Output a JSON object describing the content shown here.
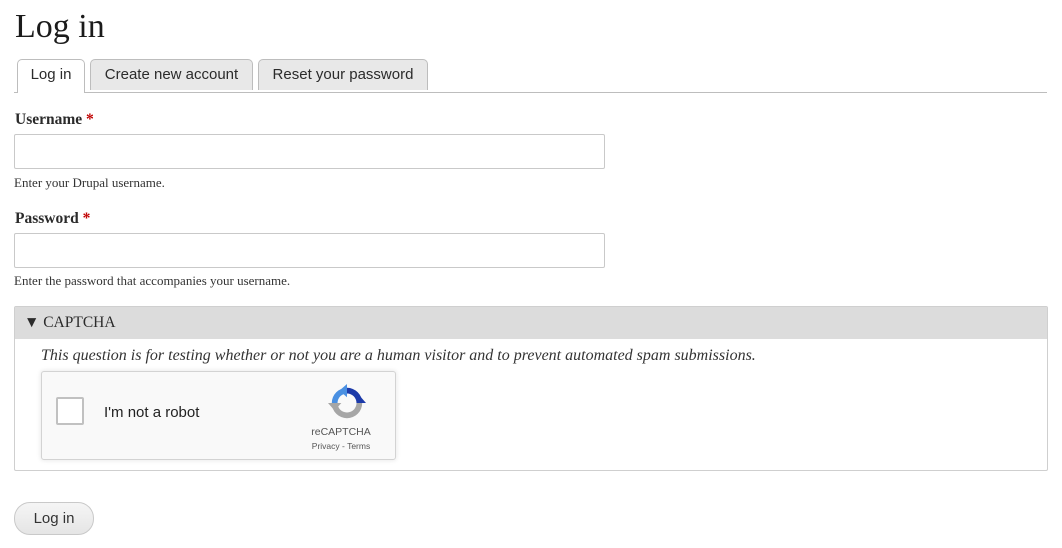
{
  "page": {
    "title": "Log in"
  },
  "tabs": [
    {
      "label": "Log in",
      "active": true
    },
    {
      "label": "Create new account",
      "active": false
    },
    {
      "label": "Reset your password",
      "active": false
    }
  ],
  "form": {
    "username": {
      "label": "Username",
      "required_marker": "*",
      "value": "",
      "help": "Enter your Drupal username."
    },
    "password": {
      "label": "Password",
      "required_marker": "*",
      "value": "",
      "help": "Enter the password that accompanies your username."
    },
    "captcha": {
      "legend": "▼ CAPTCHA",
      "description": "This question is for testing whether or not you are a human visitor and to prevent automated spam submissions.",
      "recaptcha": {
        "checkbox_label": "I'm not a robot",
        "brand": "reCAPTCHA",
        "privacy_link": "Privacy",
        "separator": " - ",
        "terms_link": "Terms"
      }
    },
    "submit_label": "Log in"
  },
  "colors": {
    "required": "#c00000",
    "tab_inactive": "#e8e8e8",
    "captcha_header": "#dcdcdc",
    "recaptcha_blue": "#4a90e2",
    "recaptcha_grey": "#a6a6a6"
  }
}
